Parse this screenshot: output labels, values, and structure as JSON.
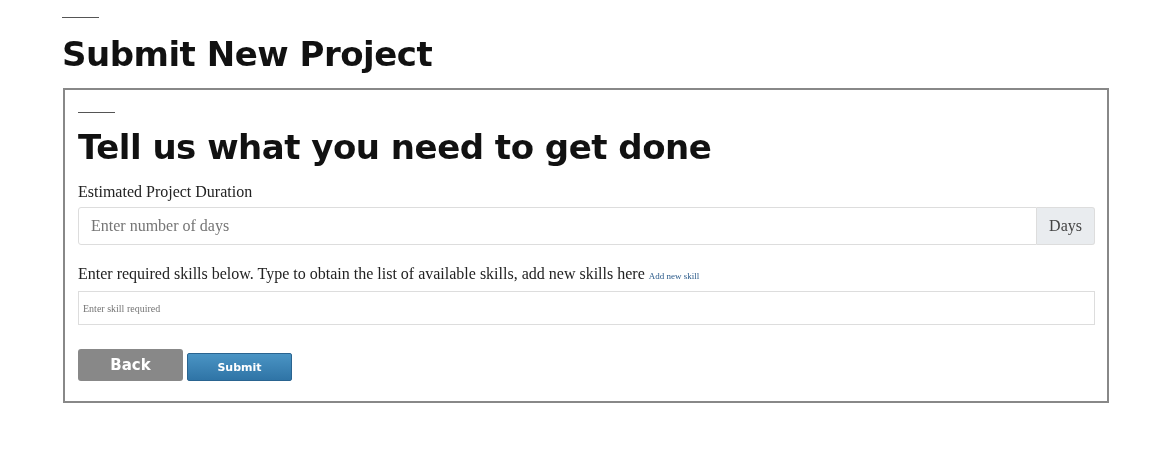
{
  "page_title": "Submit New Project",
  "form": {
    "heading": "Tell us what you need to get done",
    "duration": {
      "label": "Estimated Project Duration",
      "placeholder": "Enter number of days",
      "addon": "Days"
    },
    "skills": {
      "label": "Enter required skills below. Type to obtain the list of available skills, add new skills here",
      "link": "Add new skill",
      "placeholder": "Enter skill required"
    },
    "buttons": [
      {
        "kind": "back",
        "label": "Back"
      },
      {
        "kind": "submit",
        "label": "Submit"
      }
    ]
  }
}
